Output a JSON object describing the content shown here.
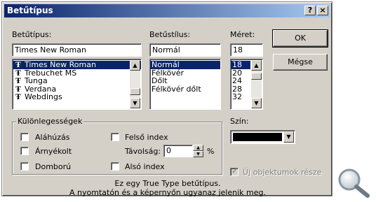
{
  "dialog": {
    "title": "Betűtípus",
    "help_label": "?",
    "close_label": "×"
  },
  "font": {
    "label": "Betűtípus:",
    "value": "Times New Roman",
    "items": [
      "Times New Roman",
      "Trebuchet MS",
      "Tunga",
      "Verdana",
      "Webdings"
    ],
    "selected_index": 0
  },
  "style": {
    "label": "Betűstílus:",
    "value": "Normál",
    "items": [
      "Normál",
      "Félkövér",
      "Dőlt",
      "Félkövér dőlt"
    ],
    "selected_index": 0
  },
  "size": {
    "label": "Méret:",
    "value": "18",
    "items": [
      "18",
      "20",
      "24",
      "28",
      "32"
    ],
    "selected_index": 0
  },
  "buttons": {
    "ok": "OK",
    "cancel": "Mégse"
  },
  "effects": {
    "group_label": "Különlegességek",
    "underline": "Aláhúzás",
    "shadow": "Árnyékolt",
    "emboss": "Domború",
    "superscript": "Felső index",
    "offset_label": "Távolság:",
    "offset_value": "0",
    "offset_unit": "%",
    "subscript": "Alsó index"
  },
  "color": {
    "label": "Szín:",
    "value_color": "#000000"
  },
  "default_for_new": {
    "label": "Új objektumok része",
    "checked": true,
    "enabled": false
  },
  "preview": {
    "line1": "Ez egy True Type betűtípus.",
    "line2": "A nyomtatón és a képernyőn ugyanaz jelenik meg."
  },
  "icons": {
    "truetype": "truetype-font-icon",
    "zoom": "magnifier-icon"
  },
  "colors": {
    "title_gradient_start": "#0a246a",
    "title_gradient_end": "#a6caf0",
    "dialog_face": "#d4d0c8",
    "selection": "#0a246a"
  }
}
